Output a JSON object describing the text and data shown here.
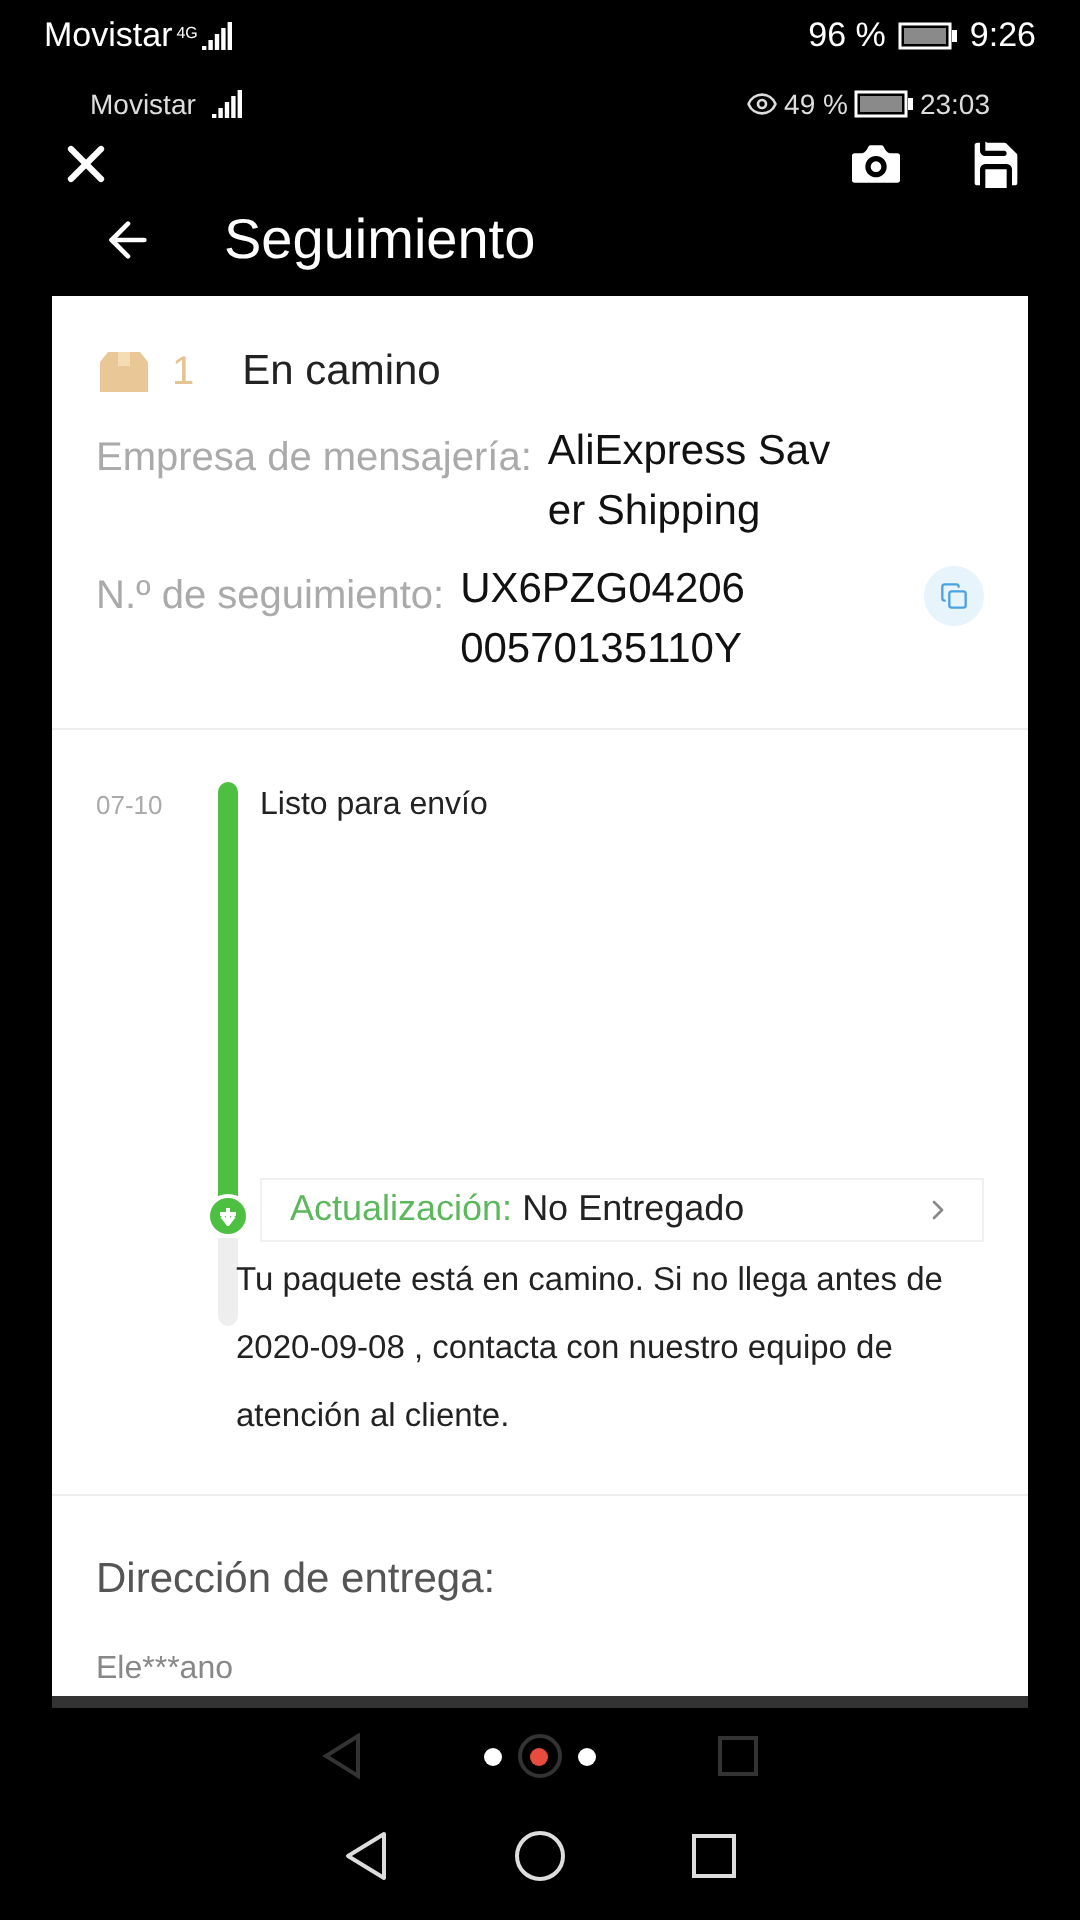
{
  "outer_status_bar": {
    "carrier": "Movistar",
    "network": "4G",
    "battery": "96 %",
    "time": "9:26"
  },
  "inner_status_bar": {
    "carrier": "Movistar",
    "battery": "49 %",
    "time": "23:03"
  },
  "viewer_toolbar": {
    "buttons": [
      {
        "kind": "close"
      },
      {
        "kind": "camera"
      },
      {
        "kind": "save"
      }
    ]
  },
  "header": {
    "title": "Seguimiento"
  },
  "package": {
    "count": "1",
    "status": "En camino"
  },
  "details": [
    {
      "label": "Empresa de mensajería:",
      "value_lines": [
        "AliExpress Sav",
        "er Shipping"
      ],
      "copyable": false
    },
    {
      "label": "N.º de seguimiento:",
      "value_lines": [
        "UX6PZG04206",
        "00570135110Y"
      ],
      "copyable": true
    }
  ],
  "timeline": {
    "events": [
      {
        "date": "07-10",
        "title": "Listo para envío"
      }
    ],
    "update": {
      "label": "Actualización:",
      "value": "No Entregado"
    },
    "message": "Tu paquete está en camino. Si no llega antes de 2020-09-08 , contacta con nuestro equipo de atención al cliente."
  },
  "delivery": {
    "title": "Dirección de entrega:",
    "name": "Ele***ano"
  },
  "page_dots": [
    {
      "selected": false
    },
    {
      "selected": true
    },
    {
      "selected": false
    }
  ]
}
